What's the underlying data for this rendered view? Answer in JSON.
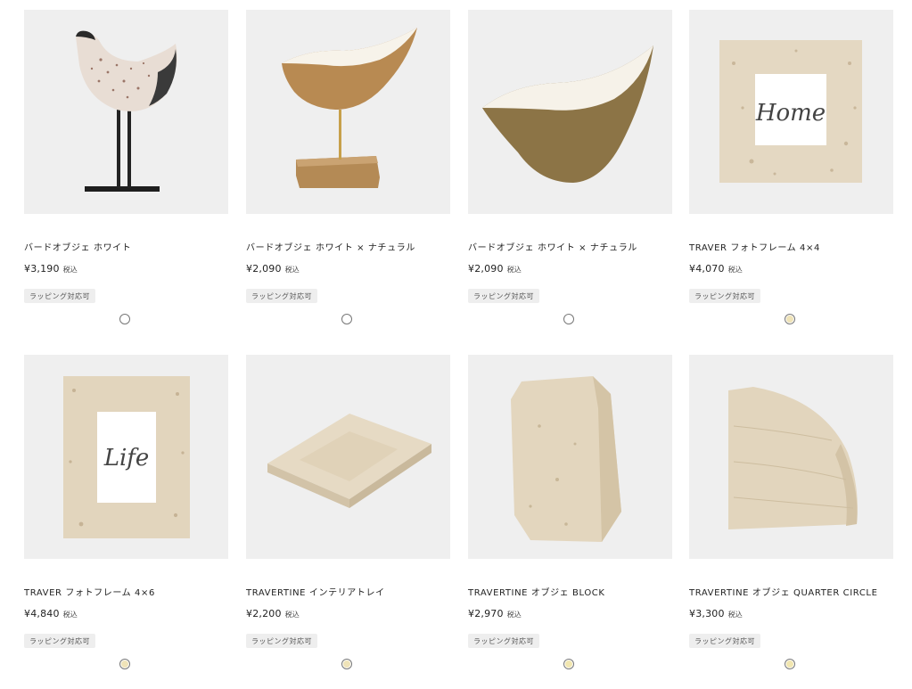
{
  "products": [
    {
      "name": "バードオブジェ ホワイト",
      "price": "¥3,190",
      "tax": "税込",
      "badge": "ラッピング対応可",
      "swatch_color": "#ffffff"
    },
    {
      "name": "バードオブジェ ホワイト × ナチュラル",
      "price": "¥2,090",
      "tax": "税込",
      "badge": "ラッピング対応可",
      "swatch_color": "#ffffff"
    },
    {
      "name": "バードオブジェ ホワイト × ナチュラル",
      "price": "¥2,090",
      "tax": "税込",
      "badge": "ラッピング対応可",
      "swatch_color": "#ffffff"
    },
    {
      "name": "TRAVER フォトフレーム 4×4",
      "price": "¥4,070",
      "tax": "税込",
      "badge": "ラッピング対応可",
      "swatch_color": "#efe3b8"
    },
    {
      "name": "TRAVER フォトフレーム 4×6",
      "price": "¥4,840",
      "tax": "税込",
      "badge": "ラッピング対応可",
      "swatch_color": "#efe3b8"
    },
    {
      "name": "TRAVERTINE インテリアトレイ",
      "price": "¥2,200",
      "tax": "税込",
      "badge": "ラッピング対応可",
      "swatch_color": "#efe3b8"
    },
    {
      "name": "TRAVERTINE オブジェ BLOCK",
      "price": "¥2,970",
      "tax": "税込",
      "badge": "ラッピング対応可",
      "swatch_color": "#f1e6b0"
    },
    {
      "name": "TRAVERTINE オブジェ QUARTER CIRCLE",
      "price": "¥3,300",
      "tax": "税込",
      "badge": "ラッピング対応可",
      "swatch_color": "#f1e6b0"
    }
  ],
  "frame_texts": {
    "home": "Home",
    "life": "Life"
  }
}
